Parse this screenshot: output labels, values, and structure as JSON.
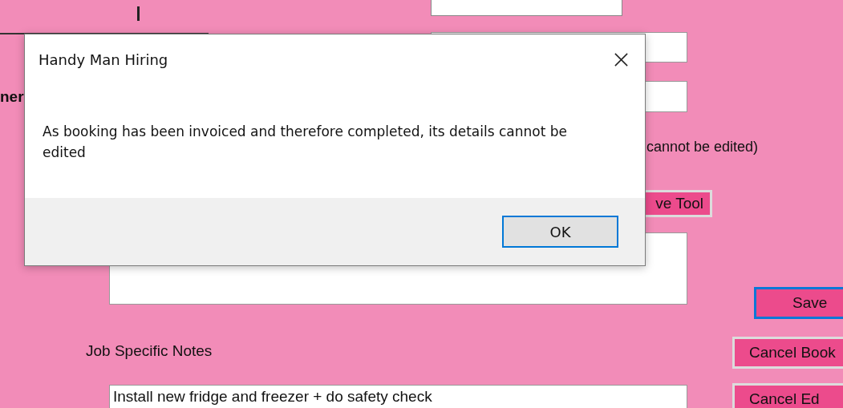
{
  "form": {
    "partial_label": "ner",
    "note": "cannot be edited)",
    "tool_button": "ve Tool",
    "job_notes_label": "Job Specific Notes",
    "job_notes_value": "Install new fridge and freezer + do safety check",
    "buttons": [
      {
        "label": "Save",
        "focused": true
      },
      {
        "label": "Cancel Book",
        "focused": false
      },
      {
        "label": "Cancel Ed",
        "focused": false
      }
    ]
  },
  "dialog": {
    "title": "Handy Man Hiring",
    "message": "As booking has been invoiced and therefore completed, its details cannot be edited",
    "ok_button": {
      "label": "OK",
      "focused": true
    }
  }
}
